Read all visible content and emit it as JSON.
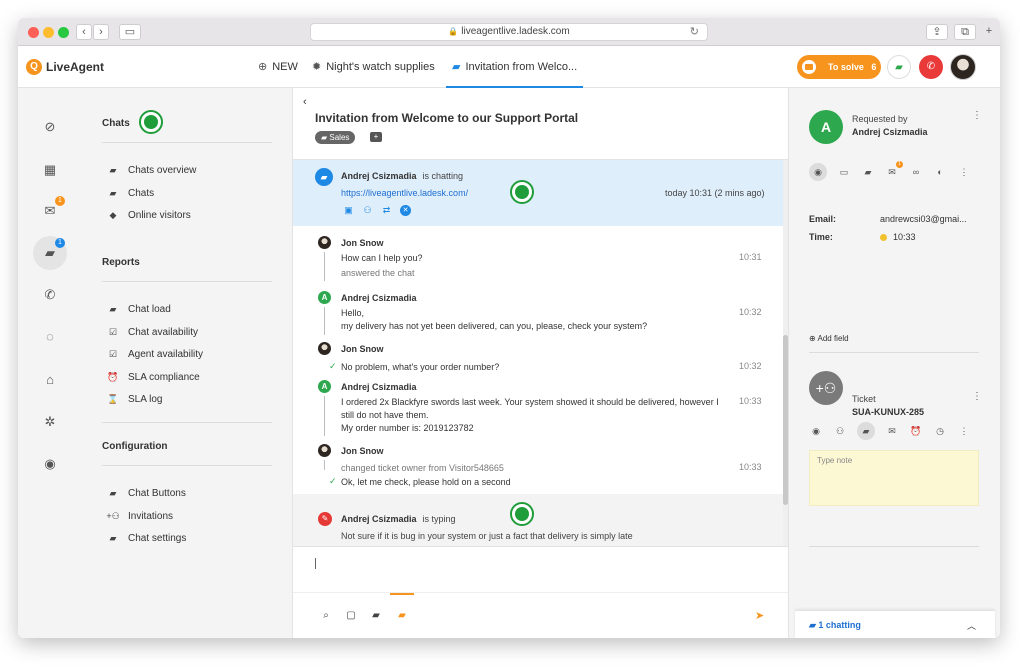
{
  "browser": {
    "url": "liveagentlive.ladesk.com",
    "nav_back": "‹",
    "nav_forward": "›"
  },
  "header": {
    "logo_text": "LiveAgent",
    "tabs": [
      {
        "label": "NEW",
        "icon": "plus-circle-icon"
      },
      {
        "label": "Night's watch supplies",
        "icon": "gear-icon"
      },
      {
        "label": "Invitation from Welco...",
        "icon": "chat-icon"
      }
    ],
    "to_solve_label": "To solve",
    "to_solve_count": "6"
  },
  "rail": {
    "email_badge": "1",
    "chat_badge": "1"
  },
  "menu": {
    "chats_heading": "Chats",
    "chats_items": [
      "Chats overview",
      "Chats",
      "Online visitors"
    ],
    "reports_heading": "Reports",
    "reports_items": [
      "Chat load",
      "Chat availability",
      "Agent availability",
      "SLA compliance",
      "SLA log"
    ],
    "config_heading": "Configuration",
    "config_items": [
      "Chat Buttons",
      "Invitations",
      "Chat settings"
    ]
  },
  "chat": {
    "back": "‹",
    "title": "Invitation from Welcome to our Support Portal",
    "tag": "Sales",
    "visitor": {
      "name": "Andrej Csizmadia",
      "status": "is chatting",
      "url": "https://liveagentlive.ladesk.com/",
      "time": "today 10:31 (2 mins ago)"
    },
    "messages": [
      {
        "author": "Jon Snow",
        "lines": [
          "How can I help you?"
        ],
        "sys": "answered the chat",
        "time": "10:31"
      },
      {
        "author": "Andrej Csizmadia",
        "lines": [
          "Hello,",
          "my delivery has not yet been delivered, can you, please, check your system?"
        ],
        "time": "10:32"
      },
      {
        "author": "Jon Snow",
        "lines": [
          "No problem, what's your order number?"
        ],
        "time": "10:32"
      },
      {
        "author": "Andrej Csizmadia",
        "lines": [
          "I ordered 2x Blackfyre swords last week. Your system showed it should be delivered, however I",
          "still do not have them.",
          "My order number is: 2019123782"
        ],
        "time": "10:33"
      },
      {
        "author": "Jon Snow",
        "sys": "changed ticket owner from Visitor548665",
        "lines": [
          "Ok, let me check, please hold on a second"
        ],
        "time": "10:33"
      }
    ],
    "typing": {
      "name": "Andrej Csizmadia",
      "status": "is typing",
      "text": "Not sure if it is bug in your system or just a fact that delivery is simply late"
    }
  },
  "right": {
    "avatar_letter": "A",
    "requested_by": "Requested by",
    "requester": "Andrej Csizmadia",
    "email_label": "Email:",
    "email_value": "andrewcsi03@gmai...",
    "time_label": "Time:",
    "time_value": "10:33",
    "add_field": "Add field",
    "ticket_label": "Ticket",
    "ticket_id": "SUA-KUNUX-285",
    "note_placeholder": "Type note",
    "chatting": "1 chatting",
    "icon_badge": "1"
  },
  "colors": {
    "accent_orange": "#f7941d",
    "accent_blue": "#1e88e5",
    "andrej_green": "#2ea84e",
    "call_red": "#ea3939"
  }
}
